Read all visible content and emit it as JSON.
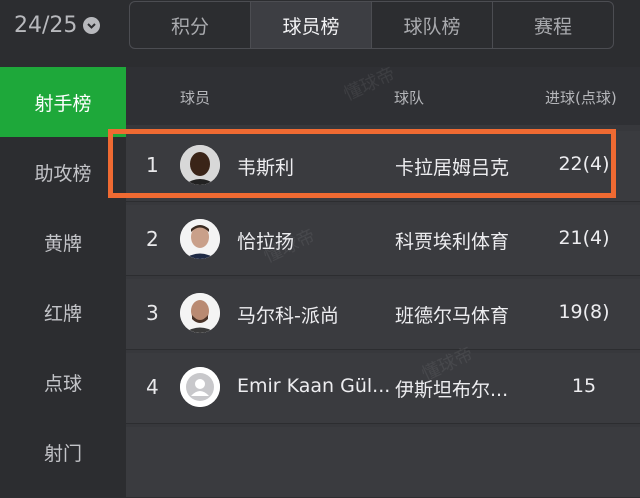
{
  "season": {
    "label": "24/25"
  },
  "tabs": [
    {
      "label": "积分",
      "active": false
    },
    {
      "label": "球员榜",
      "active": true
    },
    {
      "label": "球队榜",
      "active": false
    },
    {
      "label": "赛程",
      "active": false
    }
  ],
  "sidebar": {
    "items": [
      {
        "label": "射手榜",
        "active": true
      },
      {
        "label": "助攻榜",
        "active": false
      },
      {
        "label": "黄牌",
        "active": false
      },
      {
        "label": "红牌",
        "active": false
      },
      {
        "label": "点球",
        "active": false
      },
      {
        "label": "射门",
        "active": false
      }
    ]
  },
  "table": {
    "headers": {
      "player": "球员",
      "team": "球队",
      "goals": "进球(点球)"
    },
    "rows": [
      {
        "rank": "1",
        "name": "韦斯利",
        "team": "卡拉居姆吕克",
        "goals": "22(4)"
      },
      {
        "rank": "2",
        "name": "恰拉扬",
        "team": "科贾埃利体育",
        "goals": "21(4)"
      },
      {
        "rank": "3",
        "name": "马尔科-派尚",
        "team": "班德尔马体育",
        "goals": "19(8)"
      },
      {
        "rank": "4",
        "name": "Emir Kaan Gül...",
        "team": "伊斯坦布尔...",
        "goals": "15"
      }
    ]
  },
  "watermark": {
    "text": "懂球帝"
  },
  "colors": {
    "accent_green": "#1ea83a",
    "highlight_orange": "#ef6a32"
  }
}
